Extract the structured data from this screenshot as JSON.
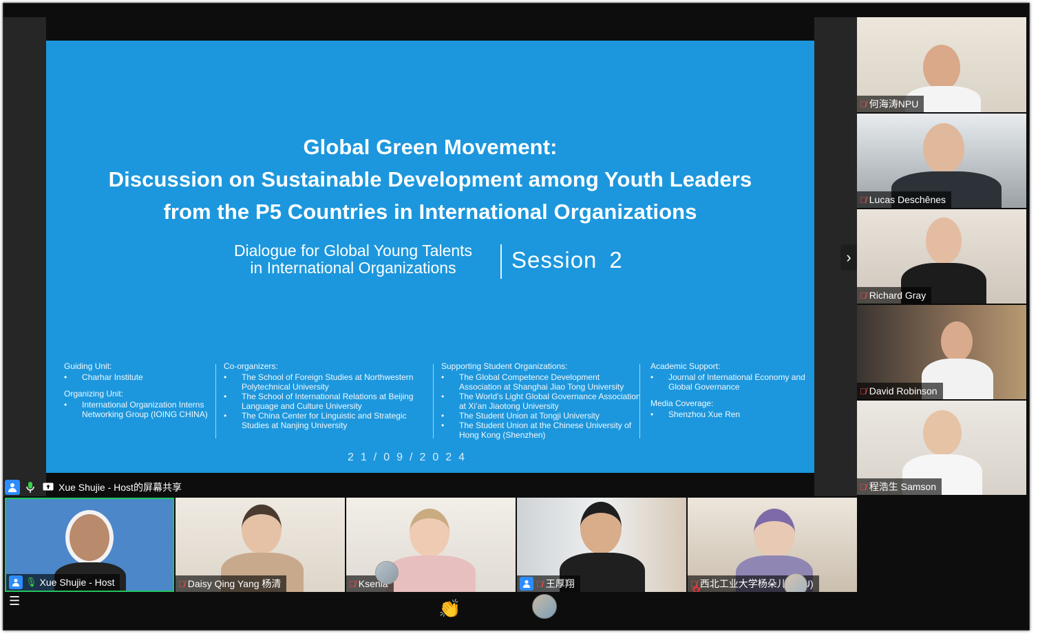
{
  "slide": {
    "title_lines": [
      "Global Green Movement:",
      "Discussion on Sustainable Development among Youth Leaders",
      "from the P5 Countries in International Organizations"
    ],
    "dialogue_lines": [
      "Dialogue for Global Young Talents",
      "in International Organizations"
    ],
    "session_label": "Session",
    "session_number": "2",
    "columns": {
      "guiding_unit": {
        "head": "Guiding Unit:",
        "items": [
          "Charhar Institute"
        ]
      },
      "organizing_unit": {
        "head": "Organizing Unit:",
        "items": [
          "International Organization Interns Networking Group (IOING CHINA)"
        ]
      },
      "co_organizers": {
        "head": "Co-organizers:",
        "items": [
          "The School of Foreign Studies at Northwestern Polytechnical University",
          "The School of International Relations at Beijing Language and Culture University",
          "The China Center for Linguistic and Strategic Studies at Nanjing University"
        ]
      },
      "supporting": {
        "head": "Supporting Student Organizations:",
        "items": [
          "The Global Competence Development Association at Shanghai Jiao Tong University",
          "The World’s Light Global Governance Association at Xi’an Jiaotong University",
          "The Student Union at Tongji University",
          "The Student Union at the Chinese University of Hong Kong (Shenzhen)"
        ]
      },
      "academic": {
        "head": "Academic Support:",
        "items": [
          "Journal of International Economy and Global Governance"
        ]
      },
      "media": {
        "head": "Media Coverage:",
        "items": [
          "Shenzhou Xue Ren"
        ]
      }
    },
    "date": "21/09/2024"
  },
  "share_banner": {
    "text": "Xue Shujie - Host的屏幕共享"
  },
  "side_participants": [
    {
      "name": "何海涛NPU",
      "muted": true
    },
    {
      "name": "Lucas Deschênes",
      "muted": true
    },
    {
      "name": "Richard Gray",
      "muted": true
    },
    {
      "name": "David Robinson",
      "muted": true
    },
    {
      "name": "程浩生 Samson",
      "muted": true
    }
  ],
  "bottom_participants": [
    {
      "name": "Xue Shujie - Host",
      "muted": false
    },
    {
      "name": "Daisy Qing Yang 杨清",
      "muted": true
    },
    {
      "name": "Ksenia",
      "muted": true
    },
    {
      "name": "王厚翔",
      "muted": true
    },
    {
      "name": "西北工业大学杨朵儿(NPU)",
      "muted": true
    }
  ],
  "reaction": "👏",
  "colors": {
    "slide_bg": "#1c97dd",
    "active_speaker_border": "#22c55e",
    "zoom_blue": "#2d8cff"
  }
}
